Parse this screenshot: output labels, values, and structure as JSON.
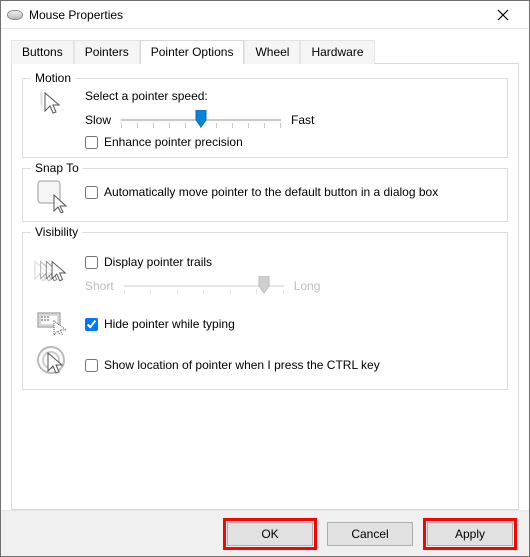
{
  "window": {
    "title": "Mouse Properties"
  },
  "tabs": {
    "buttons": "Buttons",
    "pointers": "Pointers",
    "pointer_options": "Pointer Options",
    "wheel": "Wheel",
    "hardware": "Hardware"
  },
  "motion": {
    "legend": "Motion",
    "select_label": "Select a pointer speed:",
    "slow": "Slow",
    "fast": "Fast",
    "enhance_label": "Enhance pointer precision",
    "enhance_checked": false
  },
  "snap": {
    "legend": "Snap To",
    "auto_label": "Automatically move pointer to the default button in a dialog box",
    "auto_checked": false
  },
  "visibility": {
    "legend": "Visibility",
    "trails_label": "Display pointer trails",
    "trails_checked": false,
    "trails_short": "Short",
    "trails_long": "Long",
    "hide_label": "Hide pointer while typing",
    "hide_checked": true,
    "ctrl_label": "Show location of pointer when I press the CTRL key",
    "ctrl_checked": false
  },
  "buttons": {
    "ok": "OK",
    "cancel": "Cancel",
    "apply": "Apply"
  }
}
